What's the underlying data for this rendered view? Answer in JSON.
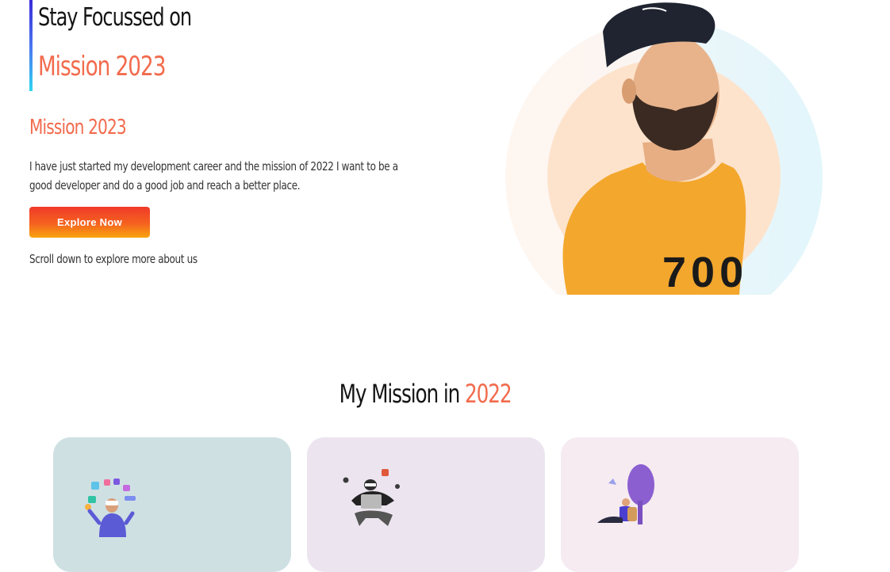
{
  "hero": {
    "line1": "Stay Focussed on",
    "line2": "Mission 2023",
    "subheading": "Mission 2023",
    "description": "I have just started my development career and the mission of 2022 I want to be a good developer and do a good job and reach a better place.",
    "cta_label": "Explore Now",
    "scroll_hint": "Scroll down to explore more about us",
    "image_icon": "portrait-photo"
  },
  "mission_section": {
    "title_prefix": "My Mission in ",
    "title_highlight": "2022",
    "cards": [
      {
        "icon": "vr-juggler-illustration",
        "background": "#cfe0e3"
      },
      {
        "icon": "laptop-person-illustration",
        "background": "#ece5ef"
      },
      {
        "icon": "reading-tree-illustration",
        "background": "#f5ebf1"
      }
    ]
  },
  "colors": {
    "accent": "#f26b4d",
    "button_gradient_start": "#f03a2a",
    "button_gradient_end": "#f9a50f"
  }
}
